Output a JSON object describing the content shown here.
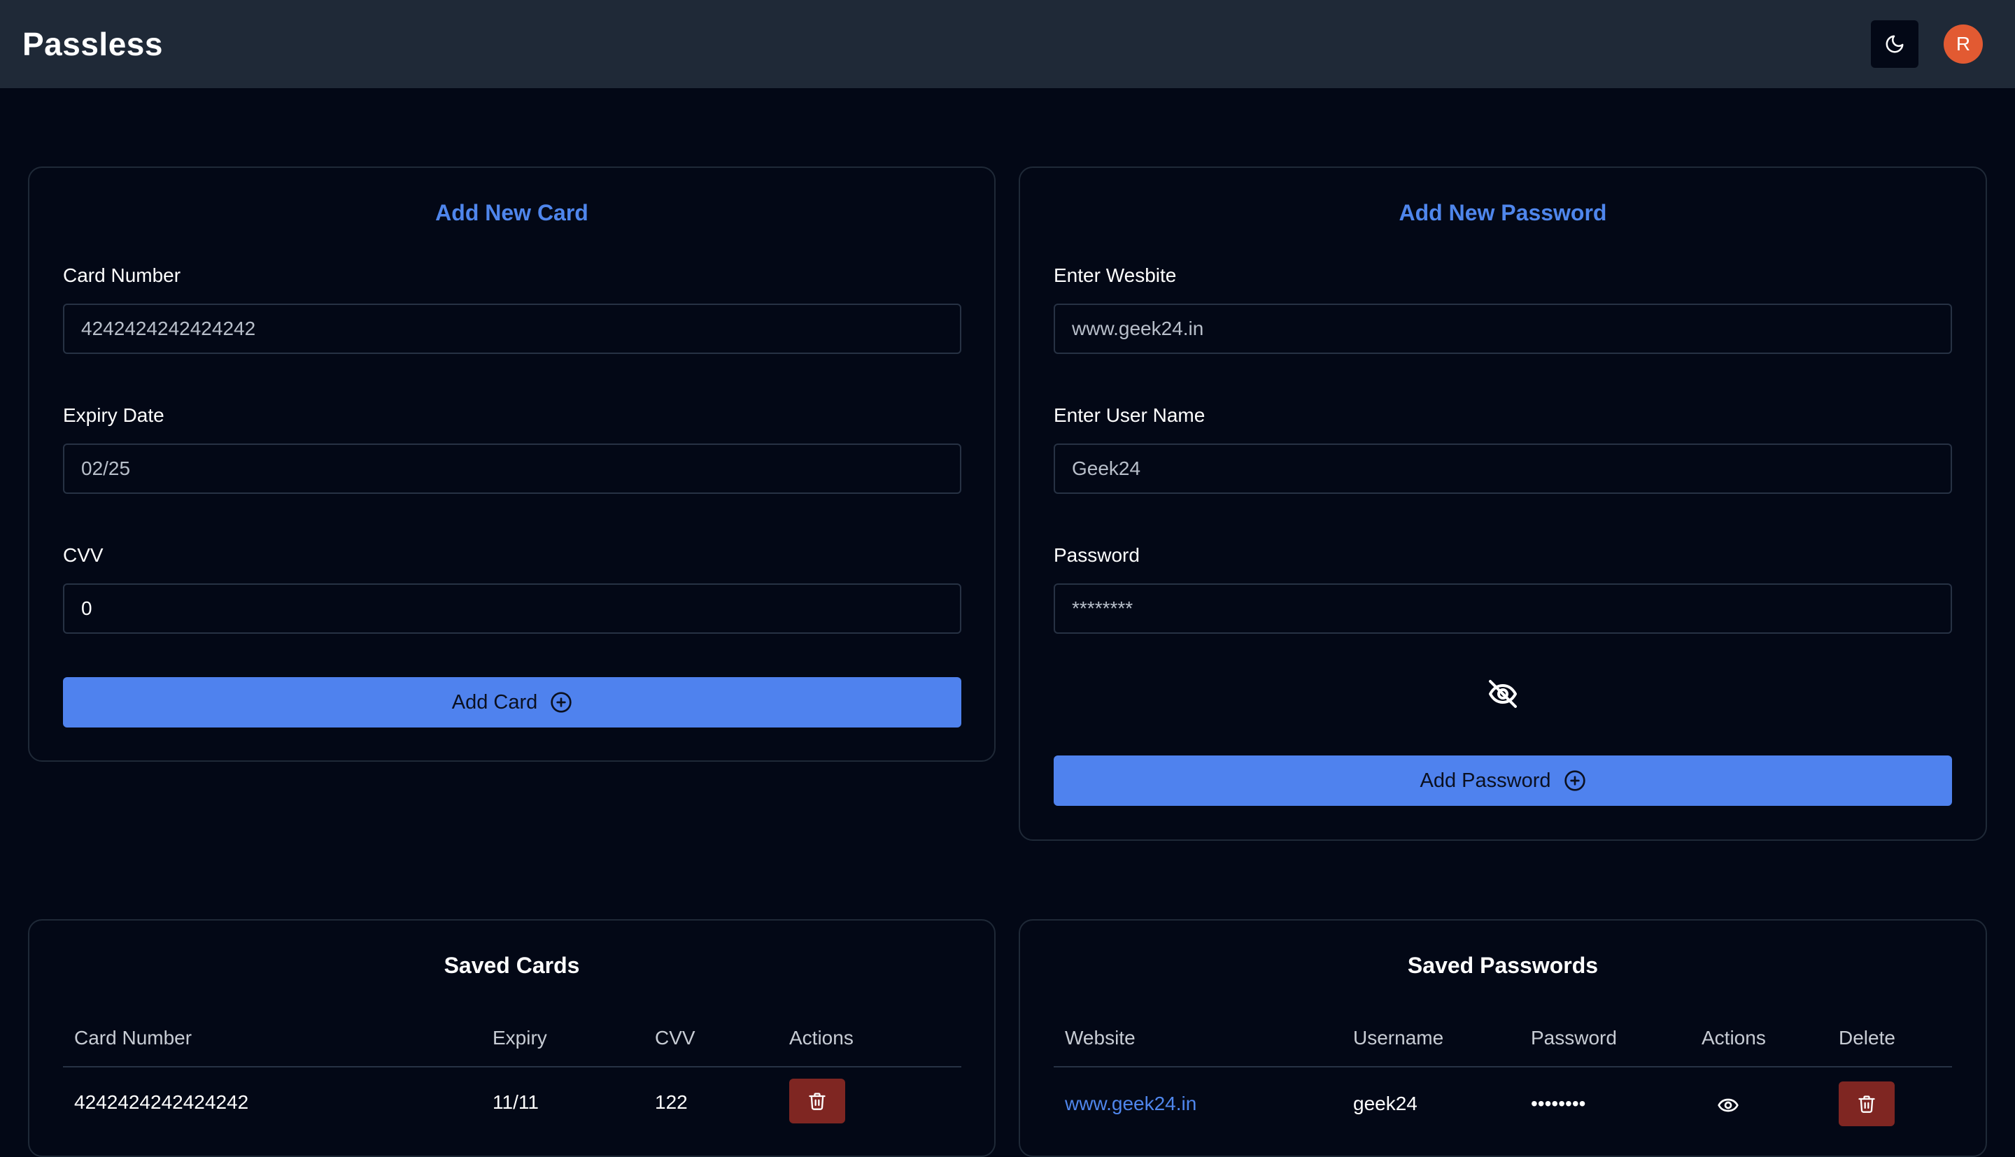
{
  "header": {
    "brand": "Passless",
    "avatar_initial": "R"
  },
  "add_card": {
    "title": "Add New Card",
    "card_number_label": "Card Number",
    "card_number_value": "4242424242424242",
    "expiry_label": "Expiry Date",
    "expiry_value": "02/25",
    "cvv_label": "CVV",
    "cvv_value": "0",
    "submit_label": "Add Card"
  },
  "add_password": {
    "title": "Add New Password",
    "website_label": "Enter Wesbite",
    "website_value": "www.geek24.in",
    "username_label": "Enter User Name",
    "username_value": "Geek24",
    "password_label": "Password",
    "password_value": "********",
    "submit_label": "Add Password"
  },
  "saved_cards": {
    "title": "Saved Cards",
    "columns": [
      "Card Number",
      "Expiry",
      "CVV",
      "Actions"
    ],
    "rows": [
      {
        "card_number": "4242424242424242",
        "expiry": "11/11",
        "cvv": "122"
      }
    ]
  },
  "saved_passwords": {
    "title": "Saved Passwords",
    "columns": [
      "Website",
      "Username",
      "Password",
      "Actions",
      "Delete"
    ],
    "rows": [
      {
        "website": "www.geek24.in",
        "username": "geek24",
        "password": "••••••••"
      }
    ]
  },
  "colors": {
    "accent": "#4f82ee",
    "header_bg": "#1f2937",
    "page_bg": "#030816",
    "danger": "#7f2622",
    "avatar": "#e25a32"
  }
}
